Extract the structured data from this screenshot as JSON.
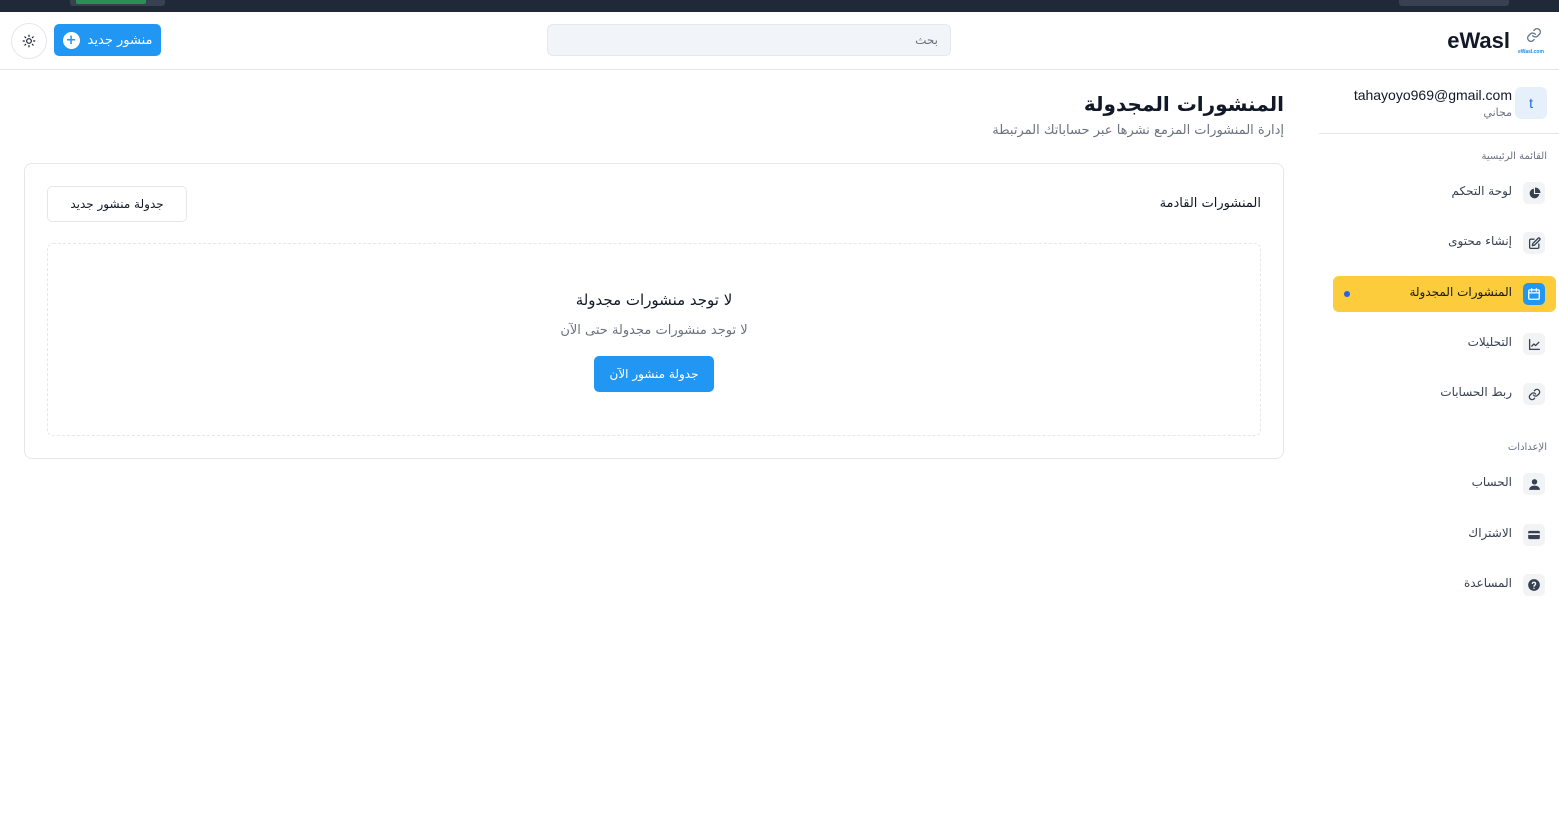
{
  "app": {
    "brand_name": "eWasl",
    "logo_caption": "eWasl.com"
  },
  "header": {
    "new_post_label": "منشور جديد",
    "search_placeholder": "بحث"
  },
  "user": {
    "avatar_initial": "t",
    "email": "tahayoyo969@gmail.com",
    "plan": "مجاني"
  },
  "sidebar": {
    "main_section_label": "القائمة الرئيسية",
    "main_items": [
      {
        "label": "لوحة التحكم",
        "icon": "pie-chart-icon"
      },
      {
        "label": "إنشاء محتوى",
        "icon": "edit-icon"
      },
      {
        "label": "المنشورات المجدولة",
        "icon": "calendar-icon",
        "active": true
      },
      {
        "label": "التحليلات",
        "icon": "line-chart-icon"
      },
      {
        "label": "ربط الحسابات",
        "icon": "link-icon"
      }
    ],
    "settings_section_label": "الإعدادات",
    "settings_items": [
      {
        "label": "الحساب",
        "icon": "user-icon"
      },
      {
        "label": "الاشتراك",
        "icon": "credit-card-icon"
      },
      {
        "label": "المساعدة",
        "icon": "help-icon"
      }
    ]
  },
  "main": {
    "title": "المنشورات المجدولة",
    "subtitle": "إدارة المنشورات المزمع نشرها عبر حساباتك المرتبطة",
    "card": {
      "title": "المنشورات القادمة",
      "schedule_new_label": "جدولة منشور جديد",
      "empty_title": "لا توجد منشورات مجدولة",
      "empty_description": "لا توجد منشورات مجدولة حتى الآن",
      "schedule_now_label": "جدولة منشور الآن"
    }
  },
  "colors": {
    "primary": "#2196f3",
    "active_nav": "#fccc3c",
    "border": "#e5e7eb",
    "muted_text": "#6b7280"
  }
}
